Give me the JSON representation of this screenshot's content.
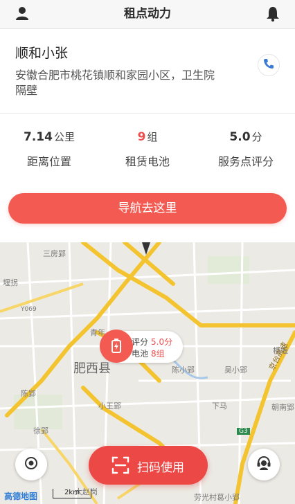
{
  "header": {
    "title": "租点动力"
  },
  "station": {
    "name": "顺和小张",
    "address": "安徽合肥市桃花镇顺和家园小区，卫生院隔壁"
  },
  "stats": [
    {
      "value": "7.14",
      "unit": "公里",
      "label": "距离位置"
    },
    {
      "value": "9",
      "unit": "组",
      "label": "租赁电池"
    },
    {
      "value": "5.0",
      "unit": "分",
      "label": "服务点评分"
    }
  ],
  "nav_button_label": "导航去这里",
  "map": {
    "places": [
      "三房郢",
      "堰拐",
      "Y069",
      "肥西县",
      "青年",
      "陈小郢",
      "吴小郢",
      "横堰",
      "京台高速",
      "陈郢",
      "小王郢",
      "下马",
      "朝南郢",
      "徐郢",
      "G3",
      "大赵岗",
      "劳光村葛小郢"
    ],
    "marker": {
      "rating_label": "评分",
      "rating_value": "5.0分",
      "battery_label": "电池",
      "battery_value": "8组"
    },
    "logo": "高德地图",
    "scale": "2km"
  },
  "scan_button_label": "扫码使用",
  "colors": {
    "accent": "#f25a52",
    "highlight_red": "#ee4e4e",
    "road_yellow": "#f4c430",
    "road_main": "#f7d667",
    "map_bg": "#eceae4"
  },
  "icons": {
    "user": "user-icon",
    "bell": "bell-icon",
    "phone": "phone-icon",
    "locate": "locate-icon",
    "service": "customer-service-icon",
    "scan": "scan-icon",
    "battery": "battery-icon"
  }
}
